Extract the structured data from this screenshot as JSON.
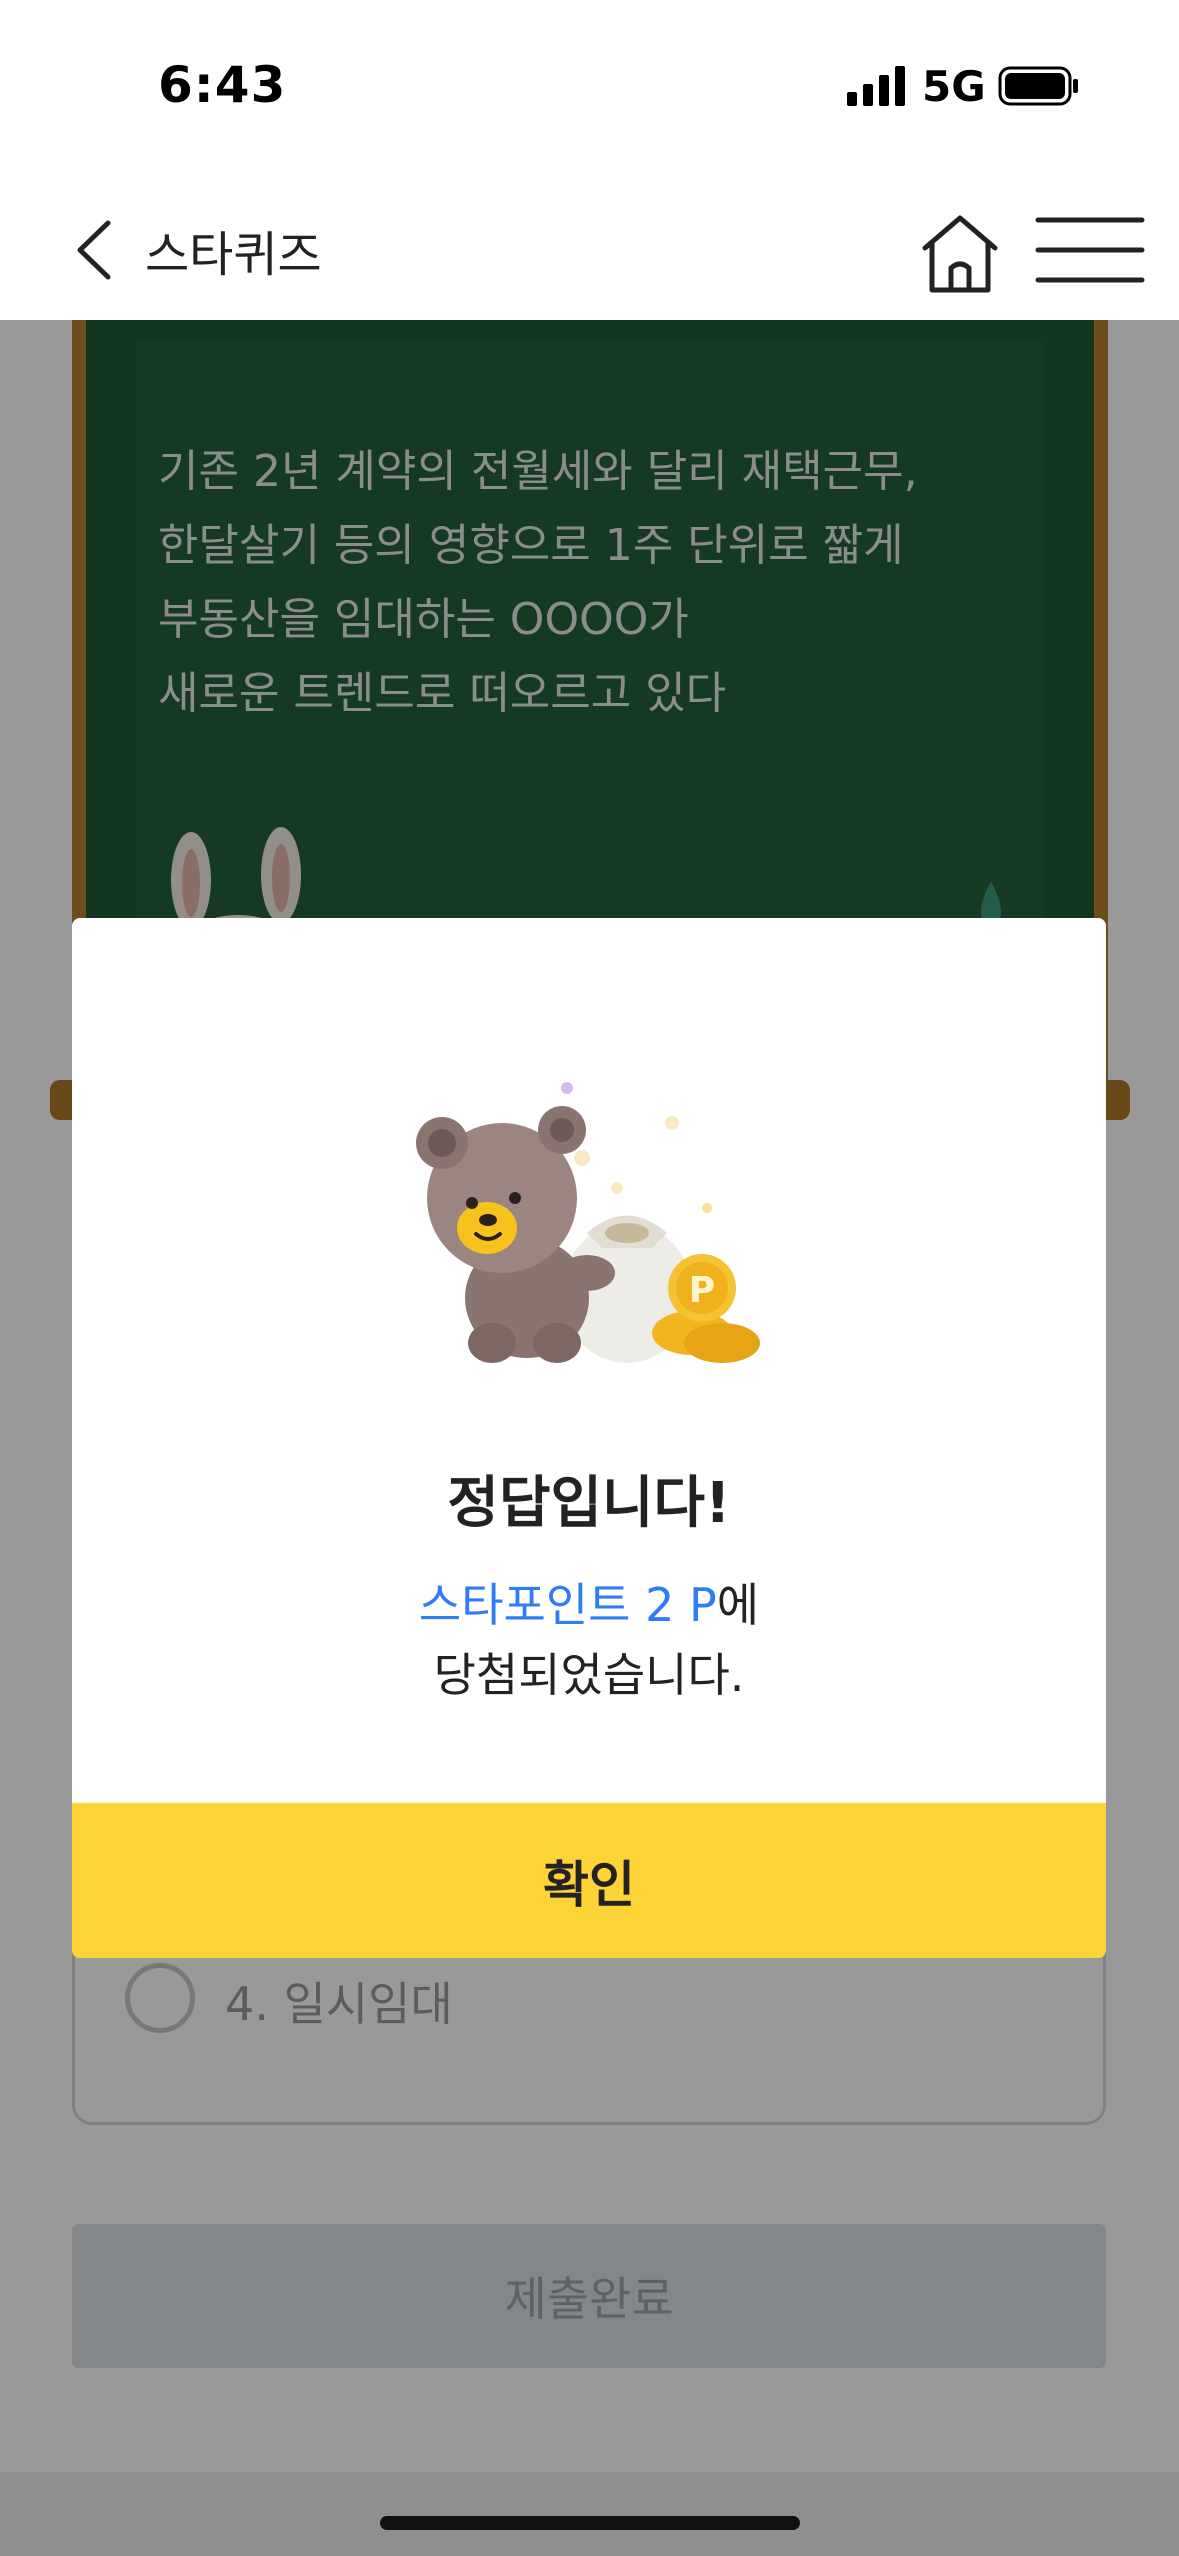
{
  "status": {
    "time": "6:43",
    "network": "5G"
  },
  "nav": {
    "title": "스타퀴즈"
  },
  "quiz": {
    "question_lines": [
      "기존 2년 계약의 전월세와 달리 재택근무,",
      "한달살기 등의 영향으로 1주 단위로 짧게",
      "부동산을 임대하는 OOOO가",
      "새로운 트렌드로 떠오르고 있다"
    ],
    "option_4": "4. 일시임대",
    "submit_label": "제출완료"
  },
  "modal": {
    "title": "정답입니다!",
    "highlight": "스타포인트 2 P",
    "msg_suffix": "에",
    "msg_line2": "당첨되었습니다.",
    "confirm_label": "확인",
    "coin_letter": "P"
  },
  "colors": {
    "board_green": "#1f5a35",
    "accent_yellow": "#fdd336",
    "highlight_blue": "#2f7cf6"
  }
}
